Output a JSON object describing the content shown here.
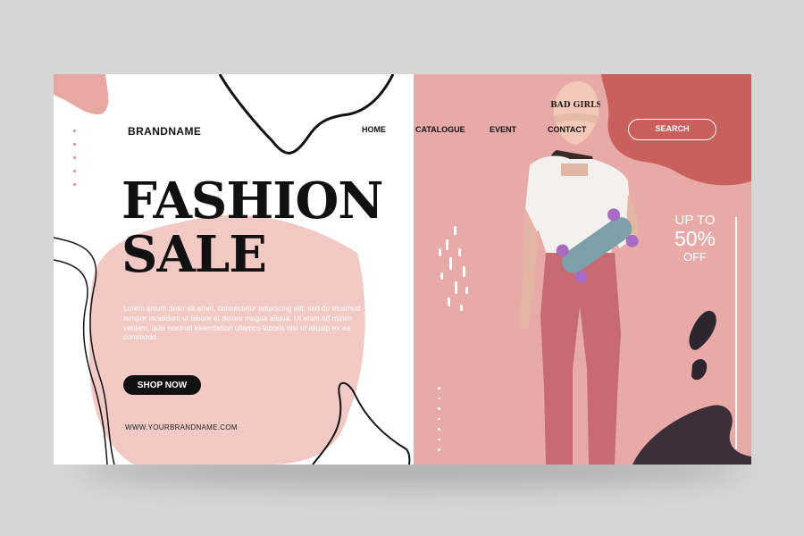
{
  "brand": {
    "name": "BRANDNAME"
  },
  "nav": {
    "items": [
      "HOME",
      "CATALOGUE",
      "EVENT",
      "CONTACT"
    ]
  },
  "search": {
    "label": "SEARCH"
  },
  "hero": {
    "headline_line1": "FASHION",
    "headline_line2": "SALE",
    "body": "Lorem ipsum dolor sit amet, consectetur adipiscing elit, sed do eiusmod tempor incididunt ut labore et dolore magna aliqua. Ut enim ad minim veniam, quis nostrud exercitation ullamco laboris nisi ut aliquip ex ea commodo.",
    "cta_label": "SHOP NOW",
    "website": "WWW.YOURBRANDNAME.COM"
  },
  "promo": {
    "line1": "UP TO",
    "line2": "50%",
    "line3": "OFF"
  },
  "photo": {
    "cap_text": "BAD GIRLS"
  },
  "colors": {
    "accent_pink": "#e7a7a3",
    "dark_pink": "#c9605b",
    "blush": "#f2c9c5",
    "ink": "#111111"
  }
}
